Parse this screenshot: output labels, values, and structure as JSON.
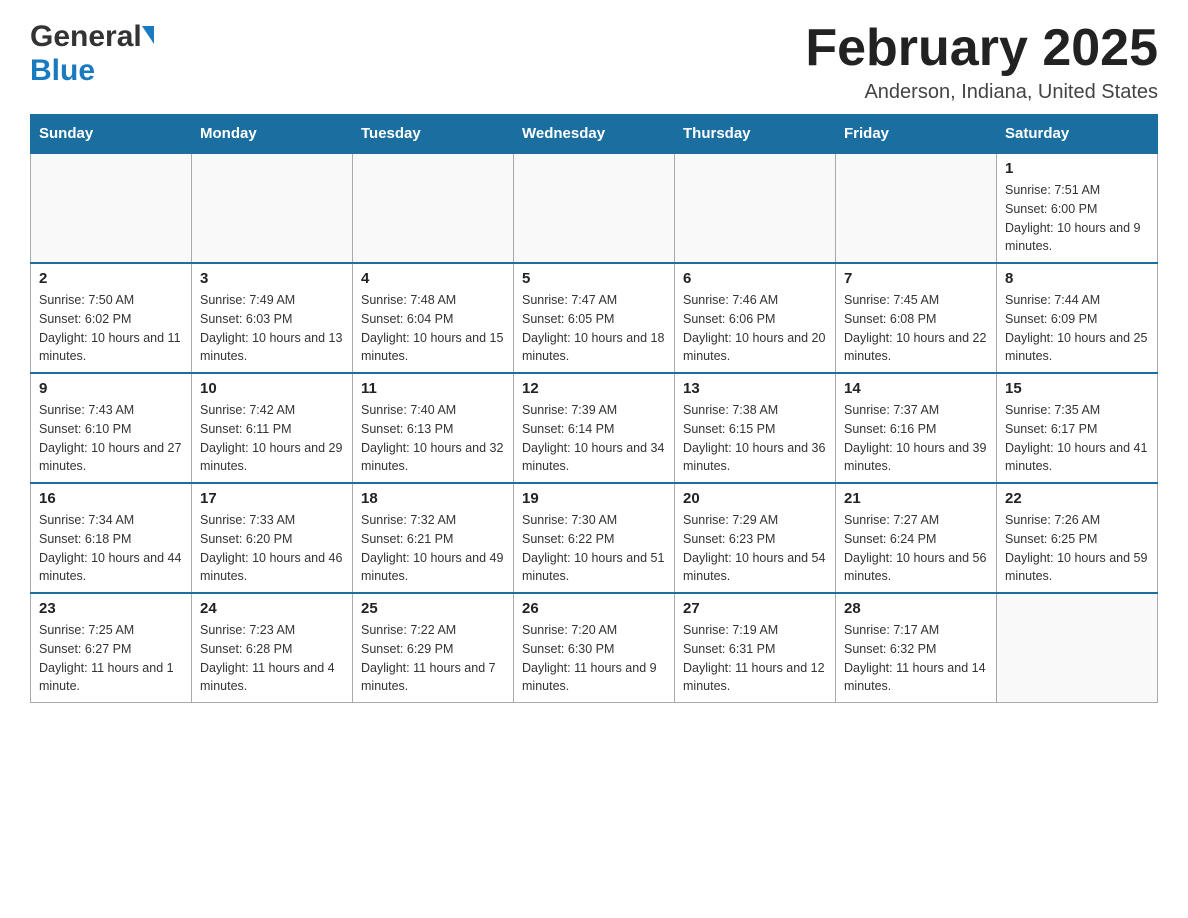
{
  "header": {
    "logo_general": "General",
    "logo_blue": "Blue",
    "month_title": "February 2025",
    "location": "Anderson, Indiana, United States"
  },
  "weekdays": [
    "Sunday",
    "Monday",
    "Tuesday",
    "Wednesday",
    "Thursday",
    "Friday",
    "Saturday"
  ],
  "weeks": [
    [
      {
        "day": "",
        "info": ""
      },
      {
        "day": "",
        "info": ""
      },
      {
        "day": "",
        "info": ""
      },
      {
        "day": "",
        "info": ""
      },
      {
        "day": "",
        "info": ""
      },
      {
        "day": "",
        "info": ""
      },
      {
        "day": "1",
        "info": "Sunrise: 7:51 AM\nSunset: 6:00 PM\nDaylight: 10 hours and 9 minutes."
      }
    ],
    [
      {
        "day": "2",
        "info": "Sunrise: 7:50 AM\nSunset: 6:02 PM\nDaylight: 10 hours and 11 minutes."
      },
      {
        "day": "3",
        "info": "Sunrise: 7:49 AM\nSunset: 6:03 PM\nDaylight: 10 hours and 13 minutes."
      },
      {
        "day": "4",
        "info": "Sunrise: 7:48 AM\nSunset: 6:04 PM\nDaylight: 10 hours and 15 minutes."
      },
      {
        "day": "5",
        "info": "Sunrise: 7:47 AM\nSunset: 6:05 PM\nDaylight: 10 hours and 18 minutes."
      },
      {
        "day": "6",
        "info": "Sunrise: 7:46 AM\nSunset: 6:06 PM\nDaylight: 10 hours and 20 minutes."
      },
      {
        "day": "7",
        "info": "Sunrise: 7:45 AM\nSunset: 6:08 PM\nDaylight: 10 hours and 22 minutes."
      },
      {
        "day": "8",
        "info": "Sunrise: 7:44 AM\nSunset: 6:09 PM\nDaylight: 10 hours and 25 minutes."
      }
    ],
    [
      {
        "day": "9",
        "info": "Sunrise: 7:43 AM\nSunset: 6:10 PM\nDaylight: 10 hours and 27 minutes."
      },
      {
        "day": "10",
        "info": "Sunrise: 7:42 AM\nSunset: 6:11 PM\nDaylight: 10 hours and 29 minutes."
      },
      {
        "day": "11",
        "info": "Sunrise: 7:40 AM\nSunset: 6:13 PM\nDaylight: 10 hours and 32 minutes."
      },
      {
        "day": "12",
        "info": "Sunrise: 7:39 AM\nSunset: 6:14 PM\nDaylight: 10 hours and 34 minutes."
      },
      {
        "day": "13",
        "info": "Sunrise: 7:38 AM\nSunset: 6:15 PM\nDaylight: 10 hours and 36 minutes."
      },
      {
        "day": "14",
        "info": "Sunrise: 7:37 AM\nSunset: 6:16 PM\nDaylight: 10 hours and 39 minutes."
      },
      {
        "day": "15",
        "info": "Sunrise: 7:35 AM\nSunset: 6:17 PM\nDaylight: 10 hours and 41 minutes."
      }
    ],
    [
      {
        "day": "16",
        "info": "Sunrise: 7:34 AM\nSunset: 6:18 PM\nDaylight: 10 hours and 44 minutes."
      },
      {
        "day": "17",
        "info": "Sunrise: 7:33 AM\nSunset: 6:20 PM\nDaylight: 10 hours and 46 minutes."
      },
      {
        "day": "18",
        "info": "Sunrise: 7:32 AM\nSunset: 6:21 PM\nDaylight: 10 hours and 49 minutes."
      },
      {
        "day": "19",
        "info": "Sunrise: 7:30 AM\nSunset: 6:22 PM\nDaylight: 10 hours and 51 minutes."
      },
      {
        "day": "20",
        "info": "Sunrise: 7:29 AM\nSunset: 6:23 PM\nDaylight: 10 hours and 54 minutes."
      },
      {
        "day": "21",
        "info": "Sunrise: 7:27 AM\nSunset: 6:24 PM\nDaylight: 10 hours and 56 minutes."
      },
      {
        "day": "22",
        "info": "Sunrise: 7:26 AM\nSunset: 6:25 PM\nDaylight: 10 hours and 59 minutes."
      }
    ],
    [
      {
        "day": "23",
        "info": "Sunrise: 7:25 AM\nSunset: 6:27 PM\nDaylight: 11 hours and 1 minute."
      },
      {
        "day": "24",
        "info": "Sunrise: 7:23 AM\nSunset: 6:28 PM\nDaylight: 11 hours and 4 minutes."
      },
      {
        "day": "25",
        "info": "Sunrise: 7:22 AM\nSunset: 6:29 PM\nDaylight: 11 hours and 7 minutes."
      },
      {
        "day": "26",
        "info": "Sunrise: 7:20 AM\nSunset: 6:30 PM\nDaylight: 11 hours and 9 minutes."
      },
      {
        "day": "27",
        "info": "Sunrise: 7:19 AM\nSunset: 6:31 PM\nDaylight: 11 hours and 12 minutes."
      },
      {
        "day": "28",
        "info": "Sunrise: 7:17 AM\nSunset: 6:32 PM\nDaylight: 11 hours and 14 minutes."
      },
      {
        "day": "",
        "info": ""
      }
    ]
  ]
}
